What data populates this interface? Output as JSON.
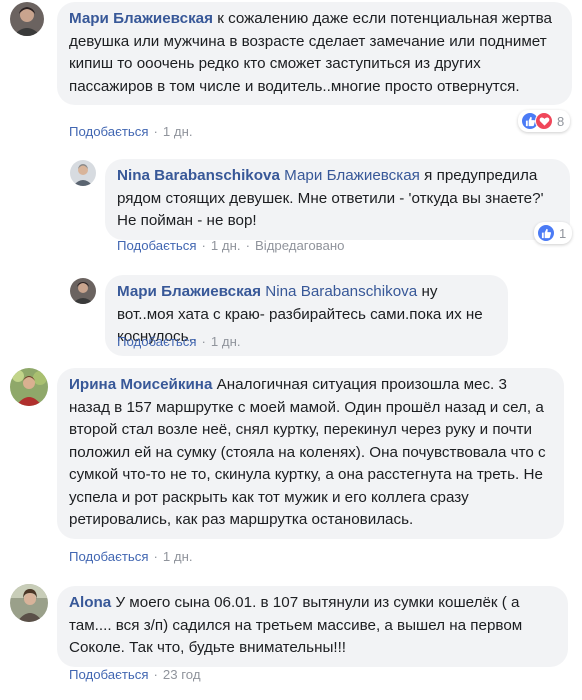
{
  "comments": [
    {
      "author": "Мари Блажиевская",
      "text": "к сожалению даже если потенциальная жертва девушка или мужчина в возрасте сделает замечание или поднимет кипиш то ооочень редко кто сможет заступиться из других пассажиров в том числе и водитель..многие просто отвернутся.",
      "like_label": "Подобається",
      "time": "1 дн.",
      "reaction_count": "8"
    },
    {
      "author": "Nina Barabanschikova",
      "mention": "Мари Блажиевская",
      "text": "я предупредила рядом стоящих девушек. Мне ответили - 'откуда вы знаете?' Не пойман - не вор!",
      "like_label": "Подобається",
      "time": "1 дн.",
      "edited": "Відредаговано",
      "reaction_count": "1"
    },
    {
      "author": "Мари Блажиевская",
      "mention": "Nina Barabanschikova",
      "text": "ну вот..моя хата с краю- разбирайтесь сами.пока их не коснулось..",
      "like_label": "Подобається",
      "time": "1 дн."
    },
    {
      "author": "Ирина Моисейкина",
      "text": "Аналогичная ситуация произошла мес. 3 назад в 157 маршрутке с моей мамой. Один прошёл назад и сел, а второй стал возле неё, снял куртку, перекинул через руку и почти положил ей на сумку (стояла на коленях). Она почувствовала что с сумкой что-то не то, скинула куртку, а она расстегнута на треть. Не успела и рот раскрыть как тот мужик и его коллега сразу ретировались, как раз маршрутка остановилась.",
      "like_label": "Подобається",
      "time": "1 дн."
    },
    {
      "author": "Alona",
      "text": "У моего сына 06.01. в 107 вытянули из сумки кошелёк ( а там.... вся з/п) садился на третьем массиве, а вышел на первом Соколе. Так что, будьте внимательны!!!",
      "like_label": "Подобається",
      "time": "23 год"
    }
  ],
  "colors": {
    "author": "#385898",
    "link": "#4267b2",
    "meta": "#90949c",
    "bubble": "#f2f3f5",
    "like": "#4b7bf5",
    "love": "#f0475a"
  },
  "icons": [
    "like-icon",
    "love-icon"
  ]
}
